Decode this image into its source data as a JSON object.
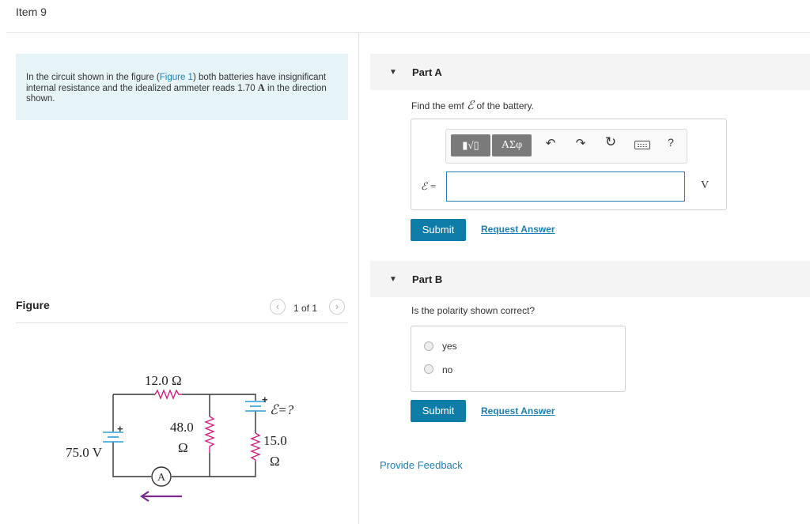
{
  "item_title": "Item 9",
  "intro": {
    "text_1": "In the circuit shown in the figure (",
    "figure_link": "Figure 1",
    "text_2": ") both batteries have insignificant internal resistance and the idealized ammeter reads 1.70 ",
    "unit": "A",
    "text_3": " in the direction shown."
  },
  "figure": {
    "label": "Figure",
    "pagination": "1 of 1",
    "prev_icon": "chevron-left-icon",
    "next_icon": "chevron-right-icon",
    "circuit": {
      "r_top": "12.0 Ω",
      "r_mid_value": "48.0",
      "r_mid_unit": "Ω",
      "r_right_value": "15.0",
      "r_right_unit": "Ω",
      "battery_left": "75.0 V",
      "battery_right": "ℰ=?",
      "ammeter": "A",
      "plus_sign": "+",
      "colors": {
        "resistor": "#d0207f",
        "battery": "#2a9fd6",
        "arrow": "#7b2a8c",
        "wire": "#333333"
      }
    }
  },
  "partA": {
    "title": "Part A",
    "question_pre": "Find the emf ",
    "question_symbol": "ℰ",
    "question_post": " of the battery.",
    "toolbar": {
      "templates_label": "▮√▯",
      "symbols_label": "ΑΣφ",
      "undo_icon": "↶",
      "redo_icon": "↷",
      "reset_icon": "↻",
      "keyboard_icon": "keyboard-icon",
      "help_label": "?"
    },
    "eq_label": "ℰ =",
    "input_value": "",
    "unit": "V",
    "submit_label": "Submit",
    "request_label": "Request Answer"
  },
  "partB": {
    "title": "Part B",
    "question": "Is the polarity shown correct?",
    "options": [
      "yes",
      "no"
    ],
    "submit_label": "Submit",
    "request_label": "Request Answer"
  },
  "feedback_label": "Provide Feedback",
  "colors": {
    "accent": "#0d7da8",
    "link": "#1f7fb2",
    "intro_bg": "#e6f4f8",
    "part_header_bg": "#f4f4f4"
  }
}
